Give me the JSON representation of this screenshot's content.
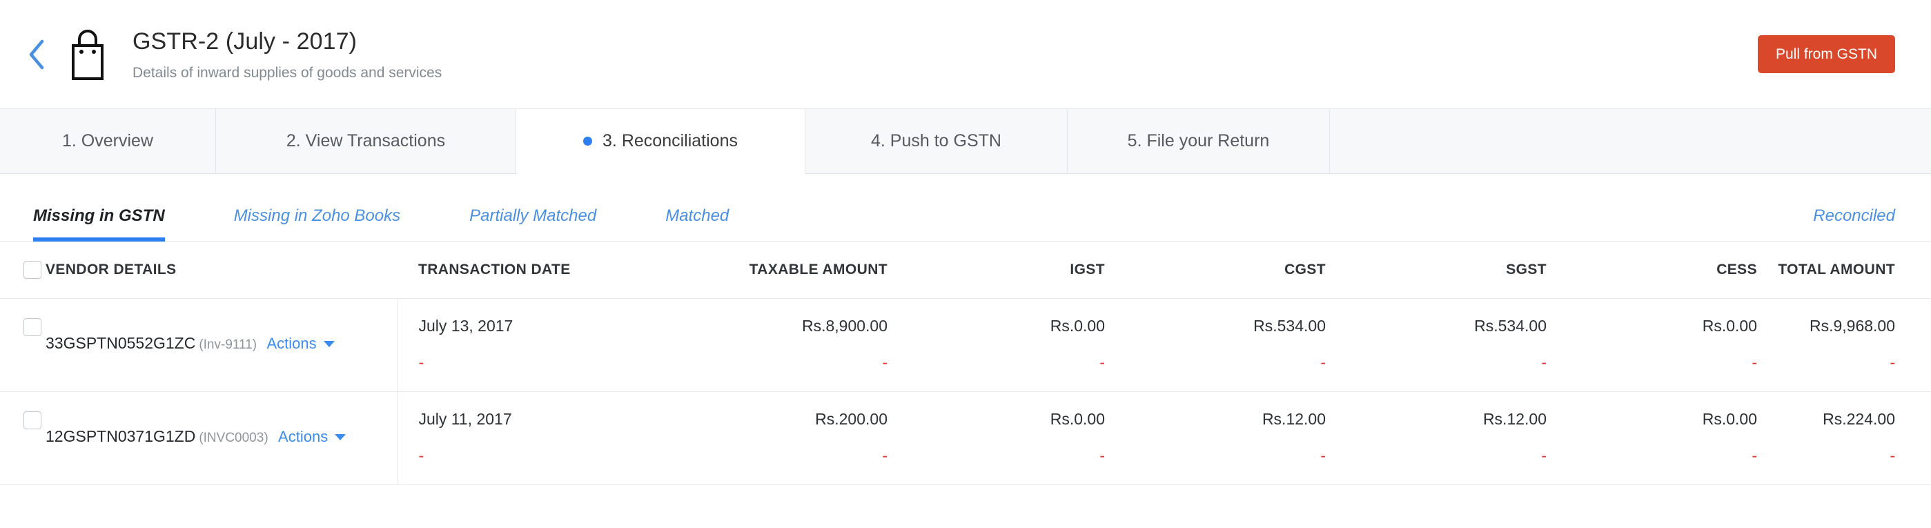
{
  "header": {
    "back_icon": "chevron-left-icon",
    "bag_icon": "shopping-bag-icon",
    "title": "GSTR-2 (July - 2017)",
    "subtitle": "Details of inward supplies of goods and services",
    "pull_button": "Pull from GSTN",
    "pull_button_color": "#d9482b"
  },
  "steps": [
    {
      "label": "1. Overview",
      "active": false
    },
    {
      "label": "2. View Transactions",
      "active": false
    },
    {
      "label": "3. Reconciliations",
      "active": true
    },
    {
      "label": "4. Push to GSTN",
      "active": false
    },
    {
      "label": "5. File your Return",
      "active": false
    }
  ],
  "step_active_dot_color": "#2d7ff0",
  "subtabs": [
    {
      "label": "Missing in GSTN",
      "active": true
    },
    {
      "label": "Missing in Zoho Books",
      "active": false
    },
    {
      "label": "Partially Matched",
      "active": false
    },
    {
      "label": "Matched",
      "active": false
    }
  ],
  "reconciled_link": "Reconciled",
  "table": {
    "headers": {
      "vendor": "VENDOR DETAILS",
      "date": "TRANSACTION DATE",
      "taxable": "TAXABLE AMOUNT",
      "igst": "IGST",
      "cgst": "CGST",
      "sgst": "SGST",
      "cess": "CESS",
      "total": "TOTAL AMOUNT"
    },
    "actions_label": "Actions",
    "placeholder_dash": "-",
    "rows": [
      {
        "gstin": "33GSPTN0552G1ZC",
        "reference": "(Inv-9111)",
        "date": "July 13, 2017",
        "taxable": "Rs.8,900.00",
        "igst": "Rs.0.00",
        "cgst": "Rs.534.00",
        "sgst": "Rs.534.00",
        "cess": "Rs.0.00",
        "total": "Rs.9,968.00"
      },
      {
        "gstin": "12GSPTN0371G1ZD",
        "reference": "(INVC0003)",
        "date": "July 11, 2017",
        "taxable": "Rs.200.00",
        "igst": "Rs.0.00",
        "cgst": "Rs.12.00",
        "sgst": "Rs.12.00",
        "cess": "Rs.0.00",
        "total": "Rs.224.00"
      }
    ]
  }
}
